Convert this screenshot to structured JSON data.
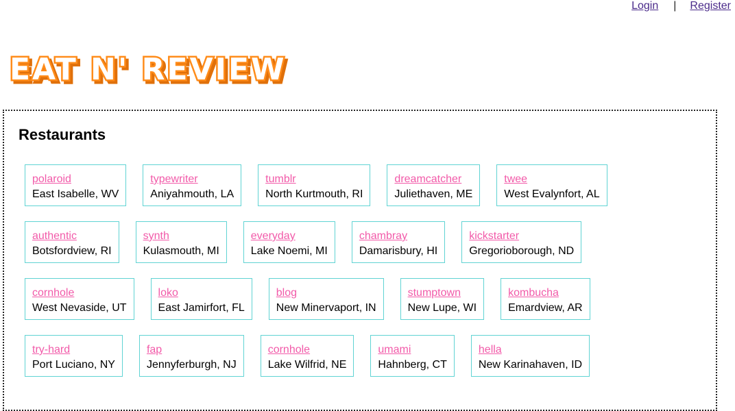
{
  "nav": {
    "login": "Login",
    "separator": "|",
    "register": "Register"
  },
  "brand": {
    "logo_text": "EAT N' REVIEW",
    "color": "#ff8c1a"
  },
  "section_title": "Restaurants",
  "colors": {
    "card_border": "#5fd3d3",
    "link": "#f25aa9"
  },
  "rows": [
    [
      {
        "name": "polaroid",
        "location": "East Isabelle, WV"
      },
      {
        "name": "typewriter",
        "location": "Aniyahmouth, LA"
      },
      {
        "name": "tumblr",
        "location": "North Kurtmouth, RI"
      },
      {
        "name": "dreamcatcher",
        "location": "Juliethaven, ME"
      },
      {
        "name": "twee",
        "location": "West Evalynfort, AL"
      }
    ],
    [
      {
        "name": "authentic",
        "location": "Botsfordview, RI"
      },
      {
        "name": "synth",
        "location": "Kulasmouth, MI"
      },
      {
        "name": "everyday",
        "location": "Lake Noemi, MI"
      },
      {
        "name": "chambray",
        "location": "Damarisbury, HI"
      },
      {
        "name": "kickstarter",
        "location": "Gregorioborough, ND"
      }
    ],
    [
      {
        "name": "cornhole",
        "location": "West Nevaside, UT"
      },
      {
        "name": "loko",
        "location": "East Jamirfort, FL"
      },
      {
        "name": "blog",
        "location": "New Minervaport, IN"
      },
      {
        "name": "stumptown",
        "location": "New Lupe, WI"
      },
      {
        "name": "kombucha",
        "location": "Emardview, AR"
      }
    ],
    [
      {
        "name": "try-hard",
        "location": "Port Luciano, NY"
      },
      {
        "name": "fap",
        "location": "Jennyferburgh, NJ"
      },
      {
        "name": "cornhole",
        "location": "Lake Wilfrid, NE"
      },
      {
        "name": "umami",
        "location": "Hahnberg, CT"
      },
      {
        "name": "hella",
        "location": "New Karinahaven, ID"
      }
    ]
  ]
}
